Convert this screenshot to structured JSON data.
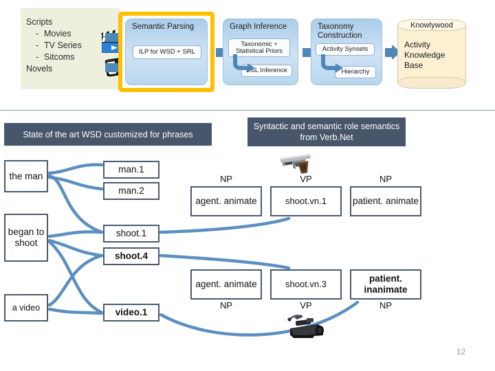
{
  "slide": {
    "page_number": "12"
  },
  "pipeline": {
    "sources": {
      "title": "Scripts",
      "items": [
        "Movies",
        "TV Series",
        "Sitcoms"
      ],
      "extra": "Novels",
      "icons": [
        "clapperboard-icon",
        "book-icon"
      ]
    },
    "stages": [
      {
        "name": "semantic-parsing",
        "title": "Semantic Parsing",
        "chips": [
          "ILP for WSD + SRL"
        ],
        "highlighted": true
      },
      {
        "name": "graph-inference",
        "title": "Graph Inference",
        "chips": [
          "Taxonomic + Statistical Priors",
          "PSL Inference"
        ],
        "highlighted": false
      },
      {
        "name": "taxonomy-construction",
        "title": "Taxonomy Construction",
        "chips": [
          "Activity Synsets",
          "Hierarchy"
        ],
        "highlighted": false
      }
    ],
    "database": {
      "title": "Knowlywood",
      "text": "Activity Knowledge Base"
    },
    "highlight_color": "#ffc000",
    "arrow_color": "#4e87b8",
    "stage_color": "#accde9"
  },
  "banners": [
    {
      "name": "wsd-banner",
      "text": "State of the art WSD customized for phrases"
    },
    {
      "name": "verbnet-banner",
      "text": "Syntactic and semantic role semantics from Verb.Net"
    }
  ],
  "phrases": [
    {
      "name": "the-man",
      "text": "the man"
    },
    {
      "name": "began-to-shoot",
      "text": "began to shoot"
    },
    {
      "name": "a-video",
      "text": "a video"
    }
  ],
  "senses": [
    {
      "name": "man-1",
      "text": "man.1",
      "bold": false
    },
    {
      "name": "man-2",
      "text": "man.2",
      "bold": false
    },
    {
      "name": "shoot-1",
      "text": "shoot.1",
      "bold": false
    },
    {
      "name": "shoot-4",
      "text": "shoot.4",
      "bold": true
    },
    {
      "name": "video-1",
      "text": "video.1",
      "bold": true
    }
  ],
  "frame_top": {
    "agent": {
      "tag": "NP",
      "text": "agent. animate"
    },
    "verb": {
      "tag": "VP",
      "text": "shoot.vn.1"
    },
    "patient": {
      "tag": "NP",
      "text": "patient. animate"
    },
    "image": "handgun-image"
  },
  "frame_bottom": {
    "agent": {
      "tag": "NP",
      "text": "agent. animate"
    },
    "verb": {
      "tag": "VP",
      "text": "shoot.vn.3"
    },
    "patient": {
      "tag": "NP",
      "text": "patient. inanimate",
      "bold": true
    },
    "image": "camcorder-image"
  },
  "colors": {
    "banner_bg": "#47566b",
    "box_border": "#4a5a6e",
    "connector": "#5b8fc0",
    "divider": "#8a9bb0"
  }
}
